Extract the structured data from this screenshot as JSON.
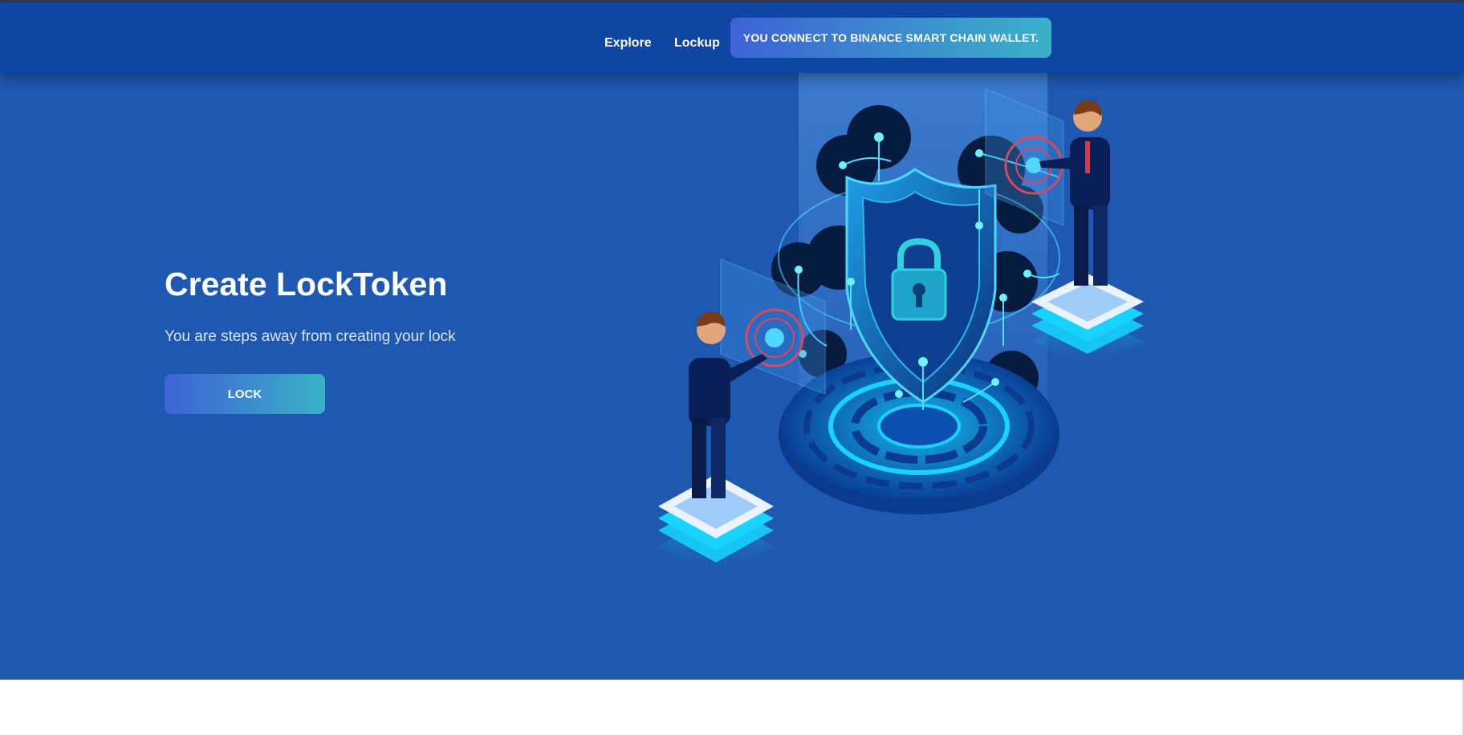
{
  "nav": {
    "links": [
      "Explore",
      "Lockup"
    ],
    "wallet_button": "YOU CONNECT TO BINANCE SMART CHAIN WALLET."
  },
  "hero": {
    "title": "Create LockToken",
    "subtitle": "You are steps away from creating your lock",
    "button": "LOCK"
  },
  "colors": {
    "navbar": "#0f46a3",
    "hero_background": "#1f58b1",
    "button_gradient_start": "#3d62d6",
    "button_gradient_end": "#3ab1c7"
  },
  "icons": [
    "security-shield-illustration",
    "padlock-icon",
    "businessman-figure"
  ]
}
